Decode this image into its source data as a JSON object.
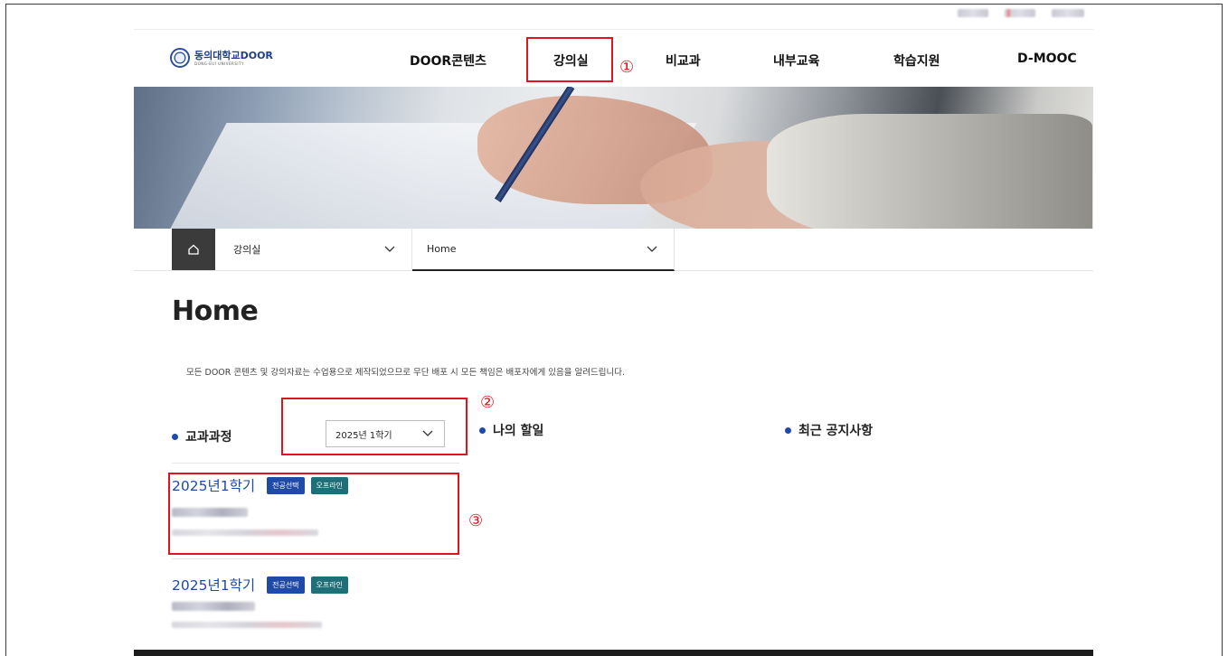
{
  "header": {
    "logo": {
      "name": "동의대학교DOOR",
      "sub": "DONG-EUI UNIVERSITY"
    },
    "nav": [
      {
        "label": "DOOR콘텐츠"
      },
      {
        "label": "강의실"
      },
      {
        "label": "비교과"
      },
      {
        "label": "내부교육"
      },
      {
        "label": "학습지원"
      },
      {
        "label": "D-MOOC"
      }
    ]
  },
  "annotations": {
    "one": "①",
    "two": "②",
    "three": "③",
    "color": "#e0141e"
  },
  "breadcrumb": {
    "home_icon": "home-icon",
    "level1": "강의실",
    "level2": "Home"
  },
  "page": {
    "title": "Home",
    "notice": "모든 DOOR 콘텐츠 및 강의자료는 수업용으로 제작되었으므로 무단 배포 시 모든 책임은 배포자에게 있음을 알려드립니다."
  },
  "sections": {
    "curriculum": "교과과정",
    "todo": "나의 할일",
    "notices": "최근 공지사항"
  },
  "semester_select": {
    "value": "2025년 1학기"
  },
  "courses": [
    {
      "semester": "2025년1학기",
      "badge1": "전공선택",
      "badge2": "오프라인"
    },
    {
      "semester": "2025년1학기",
      "badge1": "전공선택",
      "badge2": "오프라인"
    }
  ],
  "colors": {
    "accent": "#1f4aa8",
    "teal": "#1f6f78"
  }
}
